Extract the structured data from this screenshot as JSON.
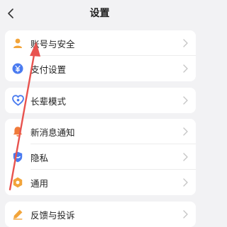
{
  "header": {
    "title": "设置",
    "back_icon": "chevron-left-icon"
  },
  "groups": [
    {
      "items": [
        {
          "label": "账号与安全",
          "icon": "user-icon",
          "icon_color": "#f2a43a"
        },
        {
          "label": "支付设置",
          "icon": "yuan-icon",
          "icon_color": "#4a7bf0"
        }
      ]
    },
    {
      "items": [
        {
          "label": "长辈模式",
          "icon": "heart-icon",
          "icon_color": "#4a7bf0"
        }
      ]
    },
    {
      "items": [
        {
          "label": "新消息通知",
          "icon": "bell-icon",
          "icon_color": "#f07a3a"
        },
        {
          "label": "隐私",
          "icon": "shield-icon",
          "icon_color": "#4a7bf0"
        },
        {
          "label": "通用",
          "icon": "gear-icon",
          "icon_color": "#f2a43a"
        }
      ]
    },
    {
      "items": [
        {
          "label": "反馈与投诉",
          "icon": "edit-icon",
          "icon_color": "#f2a43a"
        }
      ]
    }
  ],
  "colors": {
    "background": "#f2f2f4",
    "card": "#ffffff",
    "annotation_arrow": "#e8534f"
  }
}
